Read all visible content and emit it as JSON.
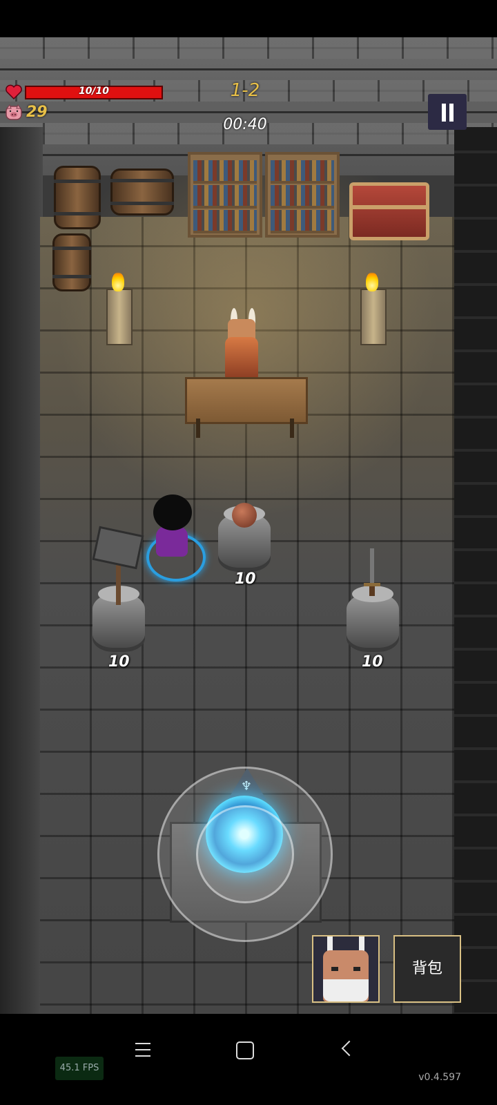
{
  "hud": {
    "hp": "10/10",
    "hp_fraction": 1.0,
    "coins": "29",
    "level": "1-2",
    "timer": "00:40"
  },
  "shop": {
    "items": [
      {
        "name": "orb",
        "price": "10"
      },
      {
        "name": "hammer",
        "price": "10"
      },
      {
        "name": "sword",
        "price": "10"
      }
    ]
  },
  "buttons": {
    "bag_label": "背包"
  },
  "debug": {
    "fps": "45.1 FPS",
    "version": "v0.4.597"
  },
  "icons": [
    "heart-icon",
    "pig-icon",
    "pause-icon",
    "menu-icon",
    "home-icon",
    "back-icon"
  ],
  "colors": {
    "hp_bar": "#e01010",
    "gold_text": "#e8c048",
    "portal": "#39c6ff",
    "frame_gold": "#d9c084"
  }
}
